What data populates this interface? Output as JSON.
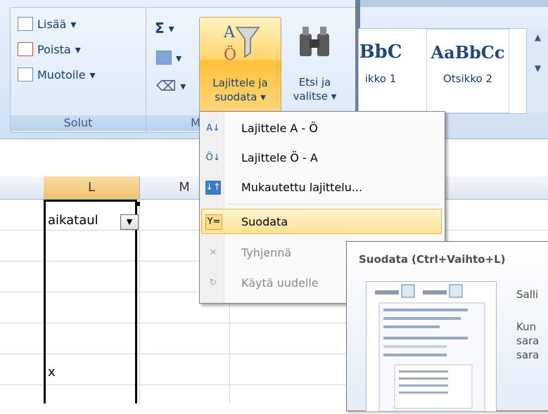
{
  "ribbon": {
    "cells": {
      "insert": "Lisää",
      "delete": "Poista",
      "format": "Muotoile",
      "caption": "Solut"
    },
    "editing": {
      "sigma": "Σ",
      "caption_partial": "M",
      "sort_filter": [
        "Lajittele ja",
        "suodata"
      ],
      "find_select": [
        "Etsi ja",
        "valitse"
      ]
    },
    "styles": [
      {
        "sample": "BbC",
        "name": "ikko 1"
      },
      {
        "sample": "AaBbCc",
        "name": "Otsikko 2"
      }
    ]
  },
  "sheet": {
    "columns": [
      "L",
      "M"
    ],
    "cell_header": "aikataul",
    "cell_x": "x"
  },
  "menu": {
    "items": [
      {
        "label": "Lajittele A - Ö",
        "enabled": true
      },
      {
        "label": "Lajittele Ö - A",
        "enabled": true
      },
      {
        "label": "Mukautettu lajittelu...",
        "enabled": true
      },
      {
        "label": "Suodata",
        "enabled": true,
        "highlighted": true
      },
      {
        "label": "Tyhjennä",
        "enabled": false
      },
      {
        "label": "Käytä uudelle",
        "enabled": false
      }
    ]
  },
  "tooltip": {
    "title": "Suodata (Ctrl+Vaihto+L)",
    "lines": [
      "Salli",
      "Kun",
      "sara",
      "sara"
    ]
  },
  "colors": {
    "highlight": "#ffd56c",
    "accent": "#183c73"
  }
}
